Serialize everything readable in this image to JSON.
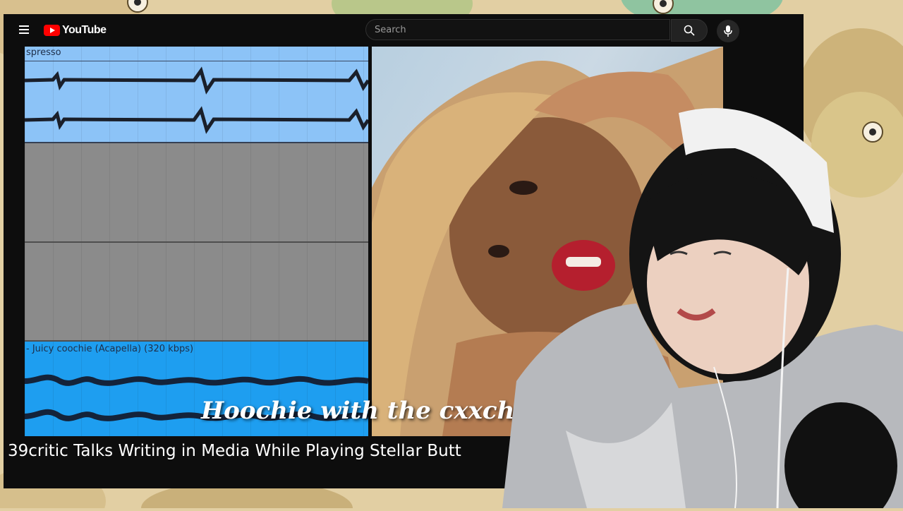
{
  "header": {
    "brand": "YouTube",
    "search_placeholder": "Search"
  },
  "video": {
    "daw": {
      "track_top_label": "spresso",
      "track_bottom_label": "- Juicy coochie (Acapella) (320 kbps)"
    },
    "caption": "Hoochie with the cxxchie"
  },
  "title": "39critic Talks Writing in Media While Playing Stellar Butt",
  "colors": {
    "youtube_red": "#ff0000",
    "track_top": "#8cc3f7",
    "track_bottom": "#1e9ef0"
  },
  "icons": [
    "menu-icon",
    "youtube-logo-icon",
    "search-icon",
    "microphone-icon"
  ]
}
